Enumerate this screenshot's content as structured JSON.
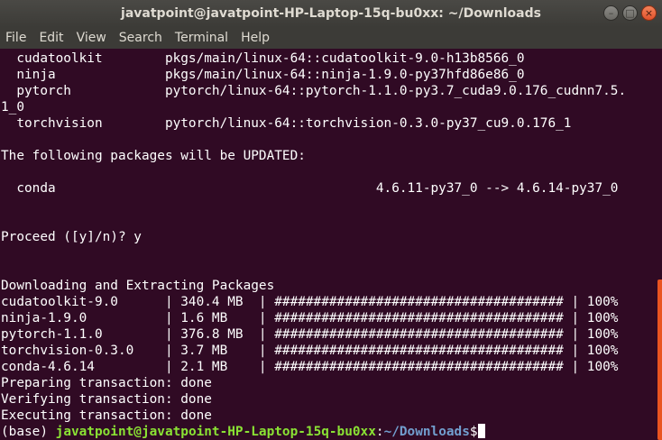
{
  "window": {
    "title": "javatpoint@javatpoint-HP-Laptop-15q-bu0xx: ~/Downloads",
    "minimize_glyph": "–",
    "maximize_glyph": "□",
    "close_glyph": "×"
  },
  "menu": {
    "items": [
      "File",
      "Edit",
      "View",
      "Search",
      "Terminal",
      "Help"
    ]
  },
  "terminal": {
    "lines": [
      "  cudatoolkit        pkgs/main/linux-64::cudatoolkit-9.0-h13b8566_0",
      "  ninja              pkgs/main/linux-64::ninja-1.9.0-py37hfd86e86_0",
      "  pytorch            pytorch/linux-64::pytorch-1.1.0-py3.7_cuda9.0.176_cudnn7.5.",
      "1_0",
      "  torchvision        pytorch/linux-64::torchvision-0.3.0-py37_cu9.0.176_1",
      "",
      "The following packages will be UPDATED:",
      "",
      "  conda                                         4.6.11-py37_0 --> 4.6.14-py37_0",
      "",
      "",
      "Proceed ([y]/n)? y",
      "",
      "",
      "Downloading and Extracting Packages",
      "cudatoolkit-9.0      | 340.4 MB  | ##################################### | 100%",
      "ninja-1.9.0          | 1.6 MB    | ##################################### | 100%",
      "pytorch-1.1.0        | 376.8 MB  | ##################################### | 100%",
      "torchvision-0.3.0    | 3.7 MB    | ##################################### | 100%",
      "conda-4.6.14         | 2.1 MB    | ##################################### | 100%",
      "Preparing transaction: done",
      "Verifying transaction: done",
      "Executing transaction: done"
    ],
    "prompt": {
      "env": "(base) ",
      "user_host": "javatpoint@javatpoint-HP-Laptop-15q-bu0xx",
      "separator": ":",
      "path": "~/Downloads",
      "symbol": "$"
    }
  },
  "colors": {
    "background": "#300a24",
    "prompt_user": "#8ae234",
    "prompt_path": "#729fcf",
    "scroll_thumb": "#e95420"
  }
}
